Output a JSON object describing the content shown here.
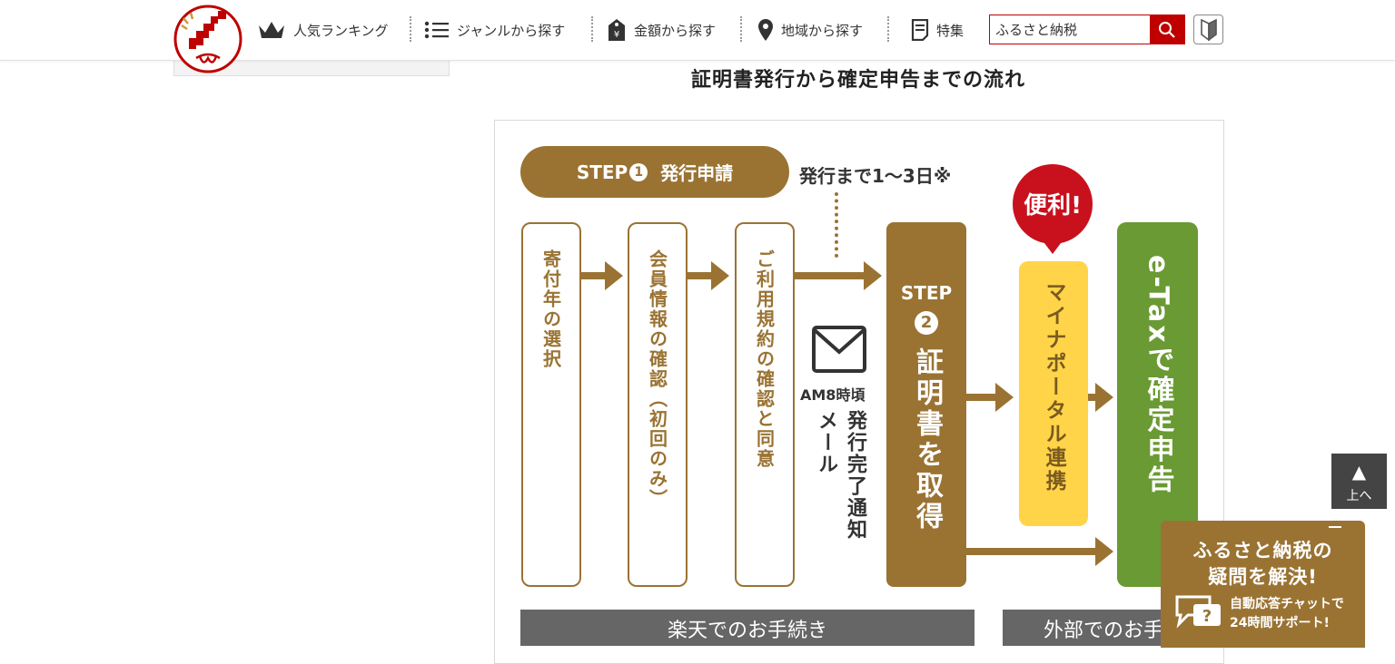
{
  "header": {
    "nav": [
      {
        "label": "人気ランキング",
        "icon": "crown-icon"
      },
      {
        "label": "ジャンルから探す",
        "icon": "list-icon"
      },
      {
        "label": "金額から探す",
        "icon": "yen-tag-icon"
      },
      {
        "label": "地域から探す",
        "icon": "map-pin-icon"
      },
      {
        "label": "特集",
        "icon": "document-icon"
      }
    ],
    "search_value": "ふるさと納税",
    "brand_color": "#bf0000"
  },
  "main": {
    "title": "証明書発行から確定申告までの流れ",
    "flow": {
      "step1_word": "STEP",
      "step1_num": "1",
      "step1_label": "発行申請",
      "days_note": "発行まで1〜3日※",
      "card1": "寄付年の選択",
      "card2": "会員情報の確認（初回のみ）",
      "card3": "ご利用規約の確認と同意",
      "mail_time": "AM8時頃",
      "mail_text": "発行完了通知メール",
      "step2_word": "STEP",
      "step2_num": "2",
      "step2_label": "証明書を取得",
      "benri": "便利!",
      "mynaportal": "マイナポータル連携",
      "etax": "e-Taxで確定申告",
      "tab_rakuten": "楽天でのお手続き",
      "tab_external": "外部でのお手続"
    }
  },
  "widgets": {
    "to_top_label": "上へ",
    "chat_title_line1": "ふるさと納税の",
    "chat_title_line2": "疑問を解決!",
    "chat_sub_line1": "自動応答チャットで",
    "chat_sub_line2": "24時間サポート!"
  },
  "colors": {
    "gold": "#9a7333",
    "green": "#6a9a33",
    "yellow": "#ffd449",
    "red": "#bf0000"
  }
}
